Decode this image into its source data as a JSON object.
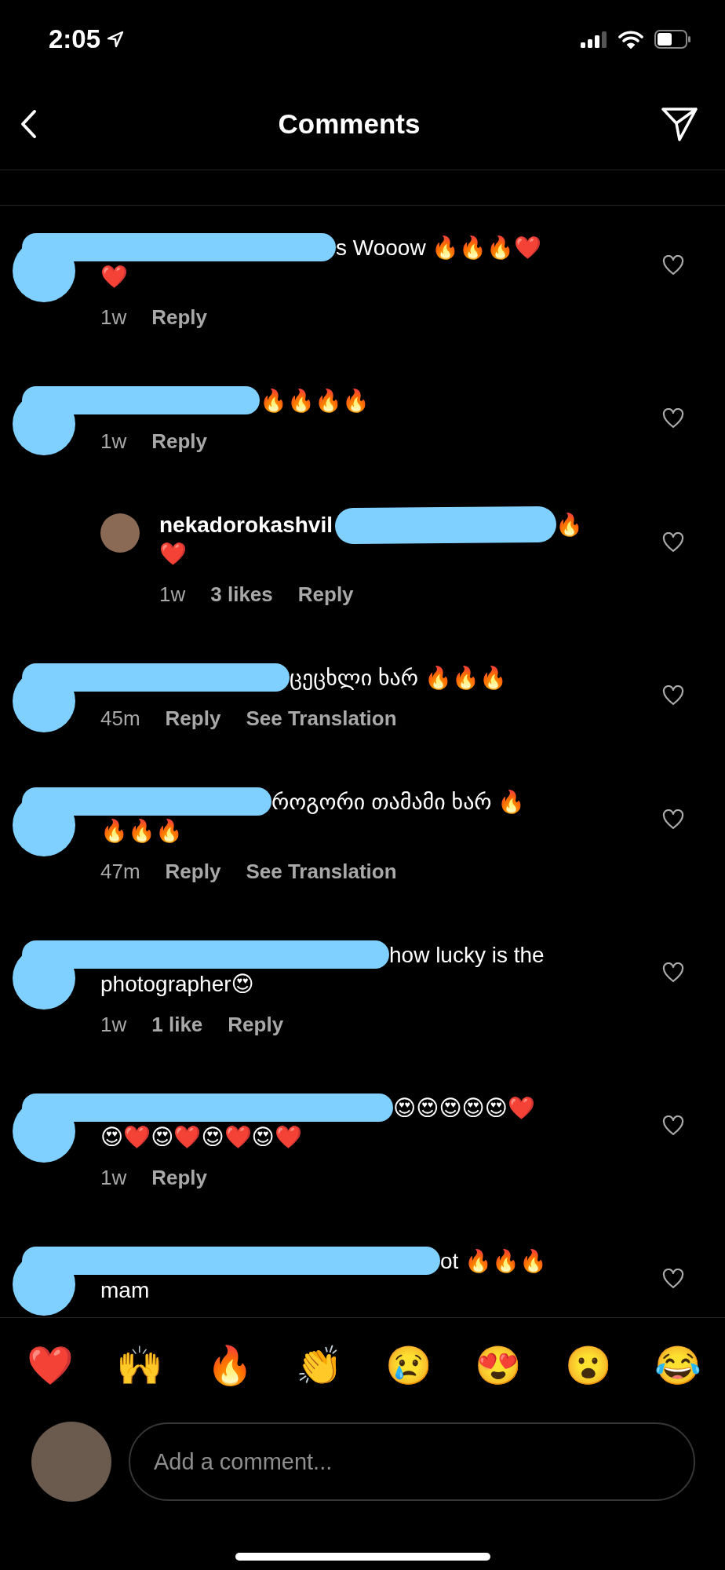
{
  "status_bar": {
    "time": "2:05"
  },
  "header": {
    "title": "Comments"
  },
  "comments": [
    {
      "text_lines": [
        "s Wooow 🔥🔥🔥❤️",
        "❤️"
      ],
      "meta": [
        {
          "kind": "time",
          "text": "1w"
        },
        {
          "kind": "action",
          "text": "Reply"
        }
      ]
    },
    {
      "text_lines": [
        "🔥🔥🔥🔥"
      ],
      "meta": [
        {
          "kind": "time",
          "text": "1w"
        },
        {
          "kind": "action",
          "text": "Reply"
        }
      ],
      "children": [
        {
          "username": "nekadorokashvil",
          "text_lines": [
            "🔥",
            "❤️"
          ],
          "meta": [
            {
              "kind": "time",
              "text": "1w"
            },
            {
              "kind": "action",
              "text": "3 likes"
            },
            {
              "kind": "action",
              "text": "Reply"
            }
          ]
        }
      ]
    },
    {
      "text_lines": [
        "ცეცხლი ხარ 🔥🔥🔥"
      ],
      "meta": [
        {
          "kind": "time",
          "text": "45m"
        },
        {
          "kind": "action",
          "text": "Reply"
        },
        {
          "kind": "action",
          "text": "See Translation"
        }
      ]
    },
    {
      "text_lines": [
        "როგორი თამამი ხარ 🔥",
        "🔥🔥🔥"
      ],
      "meta": [
        {
          "kind": "time",
          "text": "47m"
        },
        {
          "kind": "action",
          "text": "Reply"
        },
        {
          "kind": "action",
          "text": "See Translation"
        }
      ]
    },
    {
      "text_lines": [
        "how lucky is the",
        "photographer😍"
      ],
      "meta": [
        {
          "kind": "time",
          "text": "1w"
        },
        {
          "kind": "action",
          "text": "1 like"
        },
        {
          "kind": "action",
          "text": "Reply"
        }
      ]
    },
    {
      "text_lines": [
        "😍😍😍😍😍❤️",
        "😍❤️😍❤️😍❤️😍❤️"
      ],
      "meta": [
        {
          "kind": "time",
          "text": "1w"
        },
        {
          "kind": "action",
          "text": "Reply"
        }
      ]
    },
    {
      "text_lines": [
        "ot 🔥🔥🔥",
        "mam"
      ]
    }
  ],
  "quick_reactions": [
    "❤️",
    "🙌",
    "🔥",
    "👏",
    "😢",
    "😍",
    "😮",
    "😂"
  ],
  "comment_input": {
    "placeholder": "Add a comment..."
  }
}
